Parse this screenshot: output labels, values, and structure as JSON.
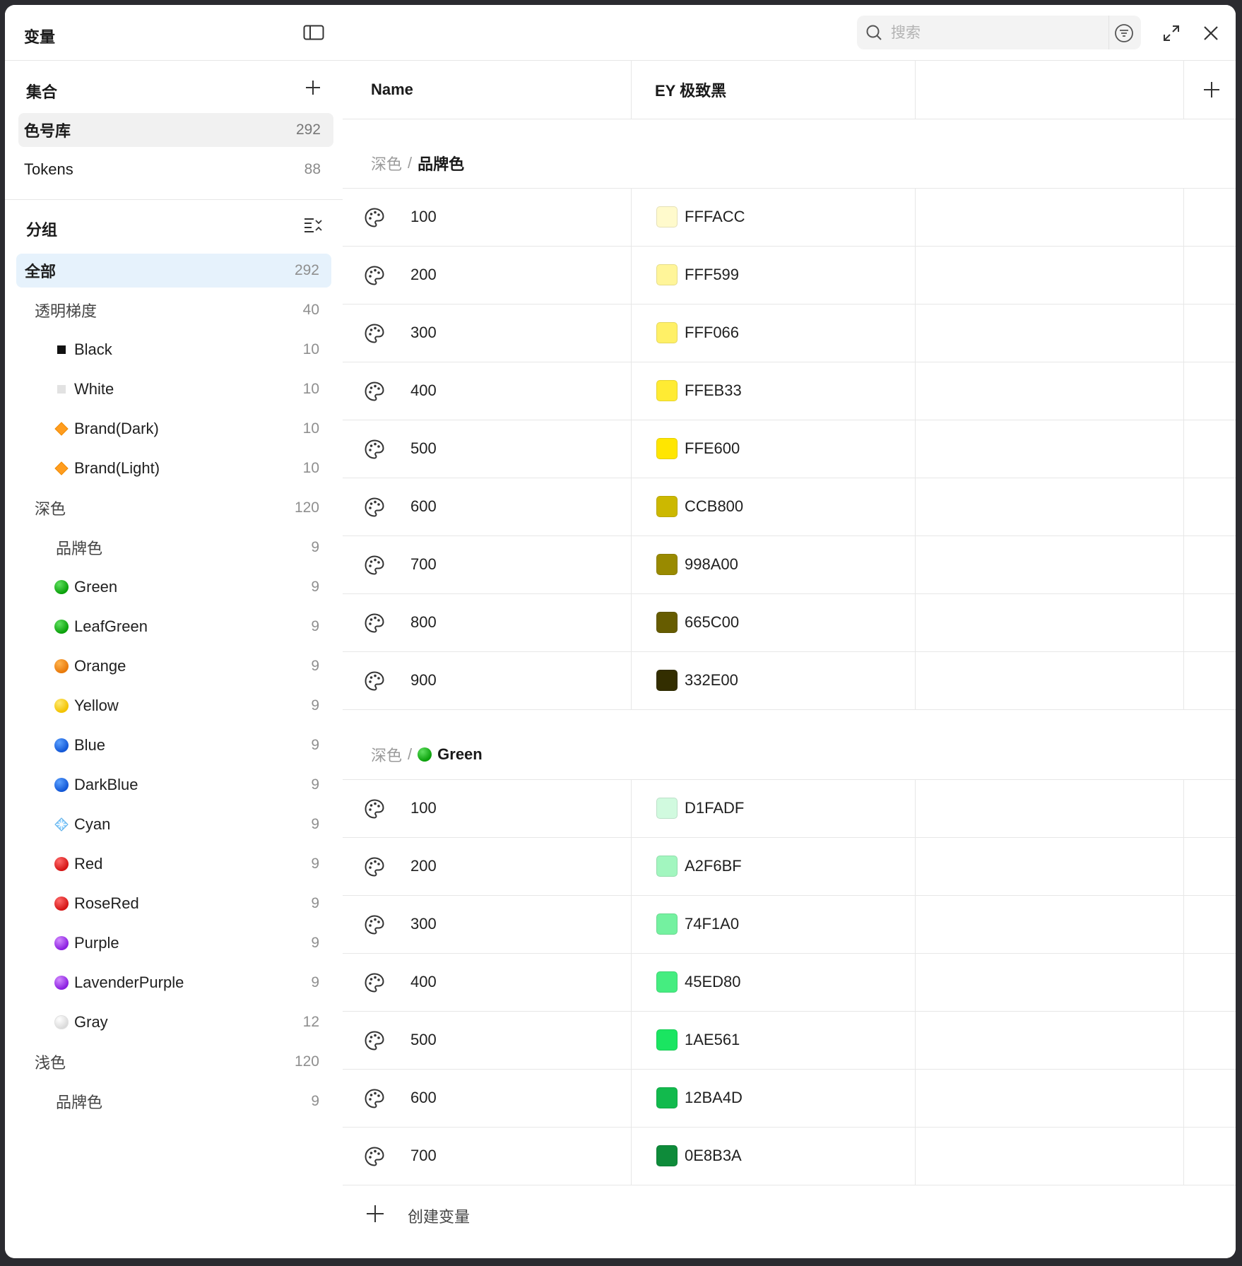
{
  "sidebar": {
    "title": "变量",
    "collections_label": "集合",
    "collections": [
      {
        "name": "色号库",
        "count": "292"
      },
      {
        "name": "Tokens",
        "count": "88"
      }
    ],
    "groups_label": "分组",
    "groups": [
      {
        "name": "全部",
        "count": "292",
        "level": 0,
        "icon": ""
      },
      {
        "name": "透明梯度",
        "count": "40",
        "level": 1,
        "icon": ""
      },
      {
        "name": "Black",
        "count": "10",
        "level": 2,
        "icon": "black-square"
      },
      {
        "name": "White",
        "count": "10",
        "level": 2,
        "icon": "white-square"
      },
      {
        "name": "Brand(Dark)",
        "count": "10",
        "level": 2,
        "icon": "orange-diamond"
      },
      {
        "name": "Brand(Light)",
        "count": "10",
        "level": 2,
        "icon": "orange-diamond"
      },
      {
        "name": "深色",
        "count": "120",
        "level": 1,
        "icon": ""
      },
      {
        "name": "品牌色",
        "count": "9",
        "level": 2,
        "icon": ""
      },
      {
        "name": "Green",
        "count": "9",
        "level": 2,
        "icon": "green-circle"
      },
      {
        "name": "LeafGreen",
        "count": "9",
        "level": 2,
        "icon": "green-circle"
      },
      {
        "name": "Orange",
        "count": "9",
        "level": 2,
        "icon": "orange-circle"
      },
      {
        "name": "Yellow",
        "count": "9",
        "level": 2,
        "icon": "yellow-circle"
      },
      {
        "name": "Blue",
        "count": "9",
        "level": 2,
        "icon": "blue-circle"
      },
      {
        "name": "DarkBlue",
        "count": "9",
        "level": 2,
        "icon": "blue-circle"
      },
      {
        "name": "Cyan",
        "count": "9",
        "level": 2,
        "icon": "cyan-diamond"
      },
      {
        "name": "Red",
        "count": "9",
        "level": 2,
        "icon": "red-circle"
      },
      {
        "name": "RoseRed",
        "count": "9",
        "level": 2,
        "icon": "red-circle"
      },
      {
        "name": "Purple",
        "count": "9",
        "level": 2,
        "icon": "purple-circle"
      },
      {
        "name": "LavenderPurple",
        "count": "9",
        "level": 2,
        "icon": "purple-circle"
      },
      {
        "name": "Gray",
        "count": "12",
        "level": 2,
        "icon": "white-circle"
      },
      {
        "name": "浅色",
        "count": "120",
        "level": 1,
        "icon": ""
      },
      {
        "name": "品牌色",
        "count": "9",
        "level": 2,
        "icon": ""
      }
    ]
  },
  "search": {
    "placeholder": "搜索"
  },
  "table": {
    "col_name": "Name",
    "col_mode": "EY 极致黑",
    "groups": [
      {
        "crumb": "深色",
        "title": "品牌色",
        "icon": "",
        "rows": [
          {
            "name": "100",
            "hex": "FFFACC"
          },
          {
            "name": "200",
            "hex": "FFF599"
          },
          {
            "name": "300",
            "hex": "FFF066"
          },
          {
            "name": "400",
            "hex": "FFEB33"
          },
          {
            "name": "500",
            "hex": "FFE600"
          },
          {
            "name": "600",
            "hex": "CCB800"
          },
          {
            "name": "700",
            "hex": "998A00"
          },
          {
            "name": "800",
            "hex": "665C00"
          },
          {
            "name": "900",
            "hex": "332E00"
          }
        ]
      },
      {
        "crumb": "深色",
        "title": "Green",
        "icon": "green-circle",
        "rows": [
          {
            "name": "100",
            "hex": "D1FADF"
          },
          {
            "name": "200",
            "hex": "A2F6BF"
          },
          {
            "name": "300",
            "hex": "74F1A0"
          },
          {
            "name": "400",
            "hex": "45ED80"
          },
          {
            "name": "500",
            "hex": "1AE561"
          },
          {
            "name": "600",
            "hex": "12BA4D"
          },
          {
            "name": "700",
            "hex": "0E8B3A"
          }
        ]
      }
    ],
    "create_label": "创建变量"
  }
}
